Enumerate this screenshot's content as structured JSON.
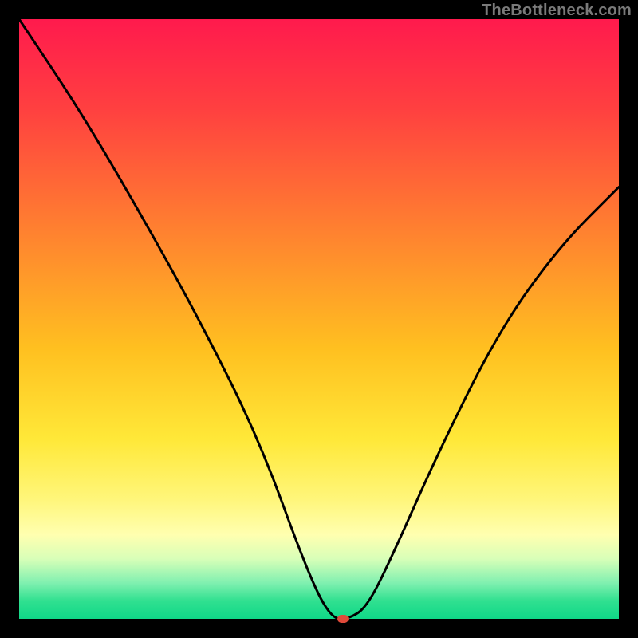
{
  "attribution": "TheBottleneck.com",
  "chart_data": {
    "type": "line",
    "title": "",
    "xlabel": "",
    "ylabel": "",
    "x_range": [
      0,
      100
    ],
    "y_range": [
      0,
      100
    ],
    "series": [
      {
        "name": "bottleneck-curve",
        "x": [
          0,
          10,
          20,
          30,
          40,
          48,
          52,
          55,
          58,
          62,
          70,
          80,
          90,
          100
        ],
        "y": [
          100,
          85,
          68,
          50,
          30,
          8,
          0,
          0,
          2,
          10,
          28,
          48,
          62,
          72
        ]
      }
    ],
    "marker": {
      "x": 54,
      "y": 0,
      "color": "#e04a3a"
    },
    "gradient_stops": [
      {
        "pct": 0,
        "color": "#ff1a4d"
      },
      {
        "pct": 15,
        "color": "#ff4040"
      },
      {
        "pct": 35,
        "color": "#ff8030"
      },
      {
        "pct": 55,
        "color": "#ffc020"
      },
      {
        "pct": 70,
        "color": "#ffe838"
      },
      {
        "pct": 80,
        "color": "#fff67a"
      },
      {
        "pct": 86,
        "color": "#ffffb0"
      },
      {
        "pct": 90,
        "color": "#d8ffb8"
      },
      {
        "pct": 94,
        "color": "#80f0b0"
      },
      {
        "pct": 97,
        "color": "#30e090"
      },
      {
        "pct": 100,
        "color": "#10d888"
      }
    ]
  }
}
